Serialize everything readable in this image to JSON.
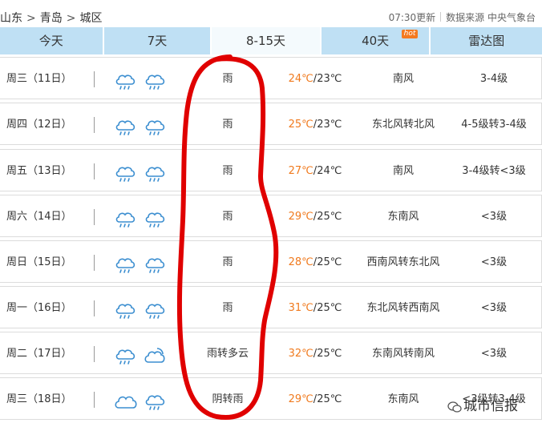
{
  "header": {
    "breadcrumb": [
      "山东",
      "青岛",
      "城区"
    ],
    "separator": ">",
    "update_time": "07:30更新",
    "source_label": "数据来源 中央气象台"
  },
  "tabs": [
    {
      "label": "今天"
    },
    {
      "label": "7天"
    },
    {
      "label": "8-15天",
      "active": true
    },
    {
      "label": "40天",
      "badge": "hot"
    },
    {
      "label": "雷达图"
    }
  ],
  "forecast": [
    {
      "date": "周三（11日）",
      "icons": [
        "rain-cloud-icon",
        "rain-cloud-icon"
      ],
      "weather": "雨",
      "high": "24℃",
      "low": "23℃",
      "wind": "南风",
      "level": "3-4级"
    },
    {
      "date": "周四（12日）",
      "icons": [
        "rain-cloud-icon",
        "rain-cloud-icon"
      ],
      "weather": "雨",
      "high": "25℃",
      "low": "23℃",
      "wind": "东北风转北风",
      "level": "4-5级转3-4级"
    },
    {
      "date": "周五（13日）",
      "icons": [
        "rain-cloud-icon",
        "rain-cloud-icon"
      ],
      "weather": "雨",
      "high": "27℃",
      "low": "24℃",
      "wind": "南风",
      "level": "3-4级转<3级"
    },
    {
      "date": "周六（14日）",
      "icons": [
        "rain-cloud-icon",
        "rain-cloud-icon"
      ],
      "weather": "雨",
      "high": "29℃",
      "low": "25℃",
      "wind": "东南风",
      "level": "<3级"
    },
    {
      "date": "周日（15日）",
      "icons": [
        "rain-cloud-icon",
        "rain-cloud-icon"
      ],
      "weather": "雨",
      "high": "28℃",
      "low": "25℃",
      "wind": "西南风转东北风",
      "level": "<3级"
    },
    {
      "date": "周一（16日）",
      "icons": [
        "rain-cloud-icon",
        "rain-cloud-icon"
      ],
      "weather": "雨",
      "high": "31℃",
      "low": "25℃",
      "wind": "东北风转西南风",
      "level": "<3级"
    },
    {
      "date": "周二（17日）",
      "icons": [
        "rain-cloud-icon",
        "partly-cloudy-icon"
      ],
      "weather": "雨转多云",
      "high": "32℃",
      "low": "25℃",
      "wind": "东南风转南风",
      "level": "<3级"
    },
    {
      "date": "周三（18日）",
      "icons": [
        "cloud-icon",
        "rain-cloud-icon"
      ],
      "weather": "阴转雨",
      "high": "29℃",
      "low": "25℃",
      "wind": "东南风",
      "level": "<3级转3-4级"
    }
  ],
  "watermark": "城市信报",
  "colors": {
    "tab_bg": "#bfe0f4",
    "active_tab_bg": "#f4fafd",
    "high_temp": "#f07a1e",
    "icon_blue": "#3b8ed0",
    "annotation": "#e00000",
    "hot_badge": "#f47a20"
  }
}
